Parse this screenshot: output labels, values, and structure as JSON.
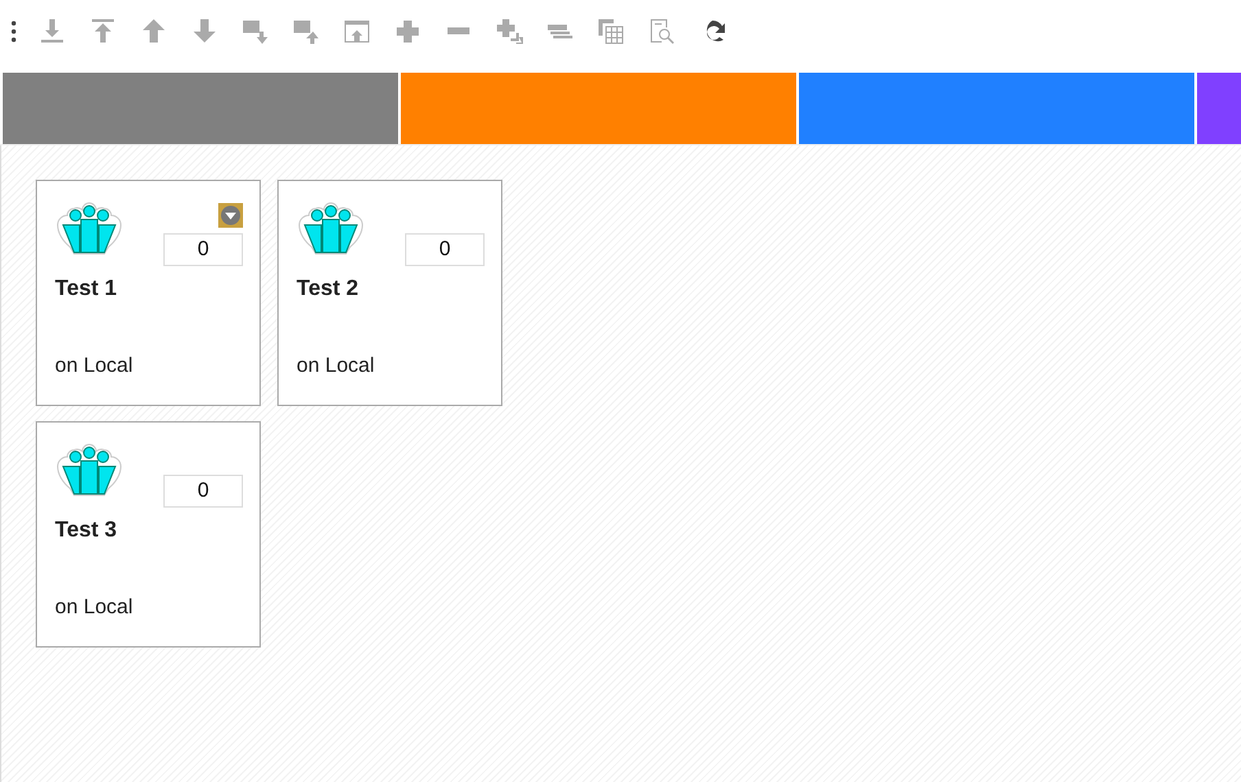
{
  "color_bands": [
    {
      "color": "#808080"
    },
    {
      "color": "#ff8000"
    },
    {
      "color": "#2080ff"
    },
    {
      "color": "#8040ff"
    }
  ],
  "cards": [
    {
      "name": "Test 1",
      "location": "on Local",
      "count": "0",
      "menu": true
    },
    {
      "name": "Test 2",
      "location": "on Local",
      "count": "0",
      "menu": false
    },
    {
      "name": "Test 3",
      "location": "on Local",
      "count": "0",
      "menu": false
    }
  ]
}
